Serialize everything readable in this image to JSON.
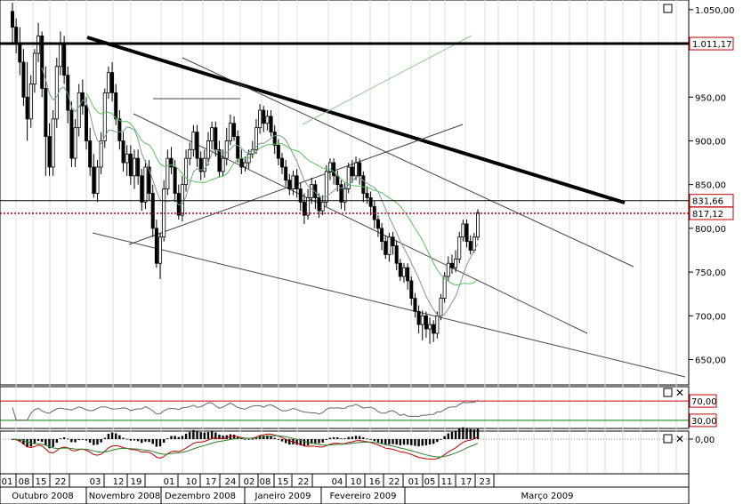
{
  "chart_data": {
    "type": "candlestick",
    "ylim": [
      620,
      1060
    ],
    "y_ticks": [
      "1.050,00",
      "950,00",
      "900,00",
      "850,00",
      "800,00",
      "750,00",
      "700,00",
      "650,00"
    ],
    "price_tags": [
      {
        "label": "1.011,17",
        "value": 1011.17,
        "color": "#c00000"
      },
      {
        "label": "831,66",
        "value": 831.66,
        "color": "#c00000"
      },
      {
        "label": "817,12",
        "value": 817.12,
        "color": "#c00000"
      }
    ],
    "x_day_labels": [
      "01",
      "08",
      "15",
      "22",
      "03",
      "12",
      "19",
      "01",
      "10",
      "17",
      "24",
      "02",
      "08",
      "15",
      "22",
      "04",
      "10",
      "16",
      "22",
      "01",
      "05",
      "11",
      "17",
      "23"
    ],
    "x_month_labels": [
      "Outubro 2008",
      "Novembro 2008",
      "Dezembro 2008",
      "Janeiro 2009",
      "Fevereiro 2009",
      "Março 2009"
    ],
    "candles": [
      [
        1048,
        1030,
        1058,
        1010
      ],
      [
        1030,
        1012,
        1040,
        1000
      ],
      [
        1012,
        990,
        1030,
        975
      ],
      [
        990,
        950,
        1005,
        940
      ],
      [
        950,
        925,
        990,
        900
      ],
      [
        925,
        965,
        975,
        915
      ],
      [
        965,
        1000,
        1005,
        955
      ],
      [
        1000,
        1020,
        1035,
        990
      ],
      [
        1020,
        960,
        1025,
        950
      ],
      [
        960,
        905,
        985,
        860
      ],
      [
        905,
        870,
        920,
        860
      ],
      [
        870,
        925,
        935,
        860
      ],
      [
        925,
        985,
        995,
        915
      ],
      [
        985,
        1010,
        1025,
        975
      ],
      [
        1010,
        975,
        1020,
        965
      ],
      [
        975,
        935,
        985,
        920
      ],
      [
        935,
        880,
        945,
        870
      ],
      [
        880,
        915,
        925,
        870
      ],
      [
        915,
        955,
        965,
        905
      ],
      [
        955,
        940,
        970,
        930
      ],
      [
        940,
        900,
        950,
        890
      ],
      [
        900,
        870,
        915,
        860
      ],
      [
        870,
        840,
        885,
        835
      ],
      [
        840,
        870,
        878,
        830
      ],
      [
        870,
        900,
        910,
        862
      ],
      [
        900,
        955,
        960,
        892
      ],
      [
        955,
        978,
        985,
        948
      ],
      [
        978,
        955,
        990,
        945
      ],
      [
        955,
        925,
        965,
        918
      ],
      [
        925,
        900,
        935,
        890
      ],
      [
        900,
        875,
        910,
        865
      ],
      [
        875,
        885,
        895,
        860
      ],
      [
        885,
        860,
        895,
        850
      ],
      [
        860,
        880,
        890,
        845
      ],
      [
        880,
        860,
        890,
        850
      ],
      [
        860,
        830,
        868,
        820
      ],
      [
        830,
        870,
        878,
        822
      ],
      [
        870,
        840,
        878,
        832
      ],
      [
        840,
        800,
        850,
        790
      ],
      [
        800,
        760,
        810,
        755
      ],
      [
        760,
        790,
        795,
        742
      ],
      [
        790,
        845,
        855,
        785
      ],
      [
        845,
        880,
        890,
        838
      ],
      [
        880,
        870,
        893,
        862
      ],
      [
        870,
        840,
        878,
        830
      ],
      [
        840,
        815,
        850,
        810
      ],
      [
        815,
        850,
        860,
        808
      ],
      [
        850,
        880,
        890,
        842
      ],
      [
        880,
        890,
        898,
        872
      ],
      [
        890,
        910,
        918,
        882
      ],
      [
        910,
        880,
        918,
        870
      ],
      [
        880,
        865,
        888,
        855
      ],
      [
        865,
        880,
        890,
        858
      ],
      [
        880,
        900,
        910,
        872
      ],
      [
        900,
        915,
        922,
        890
      ],
      [
        915,
        890,
        922,
        882
      ],
      [
        890,
        865,
        900,
        858
      ],
      [
        865,
        880,
        890,
        860
      ],
      [
        880,
        900,
        915,
        872
      ],
      [
        900,
        920,
        930,
        895
      ],
      [
        920,
        905,
        928,
        900
      ],
      [
        905,
        880,
        912,
        875
      ],
      [
        880,
        870,
        890,
        862
      ],
      [
        870,
        875,
        882,
        865
      ],
      [
        875,
        885,
        890,
        868
      ],
      [
        885,
        890,
        900,
        880
      ],
      [
        890,
        915,
        925,
        885
      ],
      [
        915,
        935,
        942,
        908
      ],
      [
        935,
        920,
        940,
        910
      ],
      [
        920,
        928,
        935,
        912
      ],
      [
        928,
        910,
        935,
        905
      ],
      [
        910,
        895,
        918,
        885
      ],
      [
        895,
        880,
        902,
        872
      ],
      [
        880,
        870,
        886,
        862
      ],
      [
        870,
        855,
        878,
        848
      ],
      [
        855,
        845,
        862,
        838
      ],
      [
        845,
        860,
        866,
        838
      ],
      [
        860,
        845,
        868,
        835
      ],
      [
        845,
        830,
        852,
        820
      ],
      [
        830,
        815,
        840,
        805
      ],
      [
        815,
        835,
        845,
        810
      ],
      [
        835,
        850,
        858,
        828
      ],
      [
        850,
        835,
        855,
        822
      ],
      [
        835,
        820,
        840,
        812
      ],
      [
        820,
        830,
        838,
        815
      ],
      [
        830,
        865,
        872,
        825
      ],
      [
        865,
        875,
        880,
        855
      ],
      [
        875,
        860,
        880,
        850
      ],
      [
        860,
        850,
        866,
        842
      ],
      [
        850,
        830,
        855,
        822
      ],
      [
        830,
        845,
        852,
        820
      ],
      [
        845,
        870,
        875,
        840
      ],
      [
        870,
        860,
        878,
        852
      ],
      [
        860,
        875,
        882,
        855
      ],
      [
        875,
        860,
        880,
        850
      ],
      [
        860,
        840,
        865,
        830
      ],
      [
        840,
        835,
        848,
        828
      ],
      [
        835,
        825,
        842,
        815
      ],
      [
        825,
        810,
        832,
        800
      ],
      [
        810,
        800,
        815,
        790
      ],
      [
        800,
        785,
        806,
        775
      ],
      [
        785,
        770,
        792,
        765
      ],
      [
        770,
        790,
        795,
        762
      ],
      [
        790,
        780,
        796,
        770
      ],
      [
        780,
        760,
        786,
        752
      ],
      [
        760,
        745,
        765,
        740
      ],
      [
        745,
        755,
        760,
        738
      ],
      [
        755,
        740,
        760,
        730
      ],
      [
        740,
        720,
        745,
        712
      ],
      [
        720,
        705,
        726,
        698
      ],
      [
        705,
        690,
        712,
        680
      ],
      [
        690,
        700,
        706,
        672
      ],
      [
        700,
        685,
        705,
        675
      ],
      [
        685,
        690,
        698,
        668
      ],
      [
        690,
        680,
        695,
        670
      ],
      [
        680,
        700,
        705,
        674
      ],
      [
        700,
        720,
        725,
        695
      ],
      [
        720,
        745,
        750,
        715
      ],
      [
        745,
        760,
        768,
        740
      ],
      [
        760,
        755,
        770,
        748
      ],
      [
        755,
        765,
        775,
        750
      ],
      [
        765,
        790,
        796,
        760
      ],
      [
        790,
        805,
        810,
        785
      ],
      [
        805,
        785,
        810,
        778
      ],
      [
        785,
        775,
        792,
        770
      ],
      [
        775,
        790,
        795,
        772
      ],
      [
        790,
        818,
        822,
        786
      ]
    ],
    "rsi": {
      "upper_label": "70,00",
      "lower_label": "30,00",
      "levels": [
        70,
        30
      ]
    },
    "macd": {
      "zero_label": "0,00"
    }
  }
}
